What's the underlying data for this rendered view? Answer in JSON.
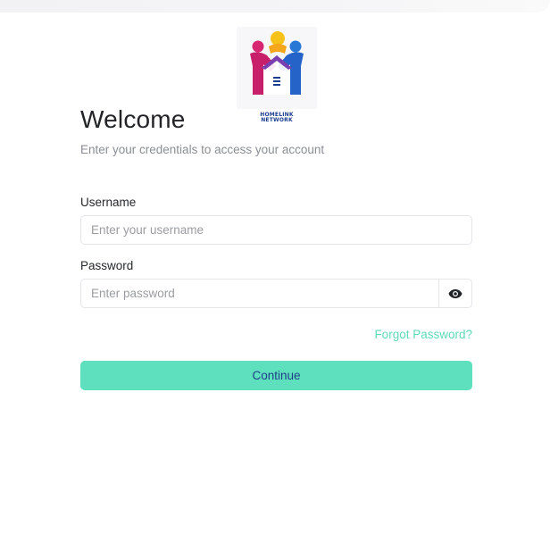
{
  "logo": {
    "line1": "HOMELINK",
    "line2": "NETWORK",
    "icon": "homelink-network-logo"
  },
  "header": {
    "title": "Welcome",
    "subtitle": "Enter your credentials to access your account"
  },
  "form": {
    "username_label": "Username",
    "username_placeholder": "Enter your username",
    "username_value": "",
    "password_label": "Password",
    "password_placeholder": "Enter password",
    "password_value": "",
    "toggle_icon": "eye-icon",
    "forgot_label": "Forgot Password?",
    "submit_label": "Continue"
  },
  "colors": {
    "accent": "#5ee0bf",
    "link": "#5fd9b8",
    "button_text": "#1d3f86"
  }
}
